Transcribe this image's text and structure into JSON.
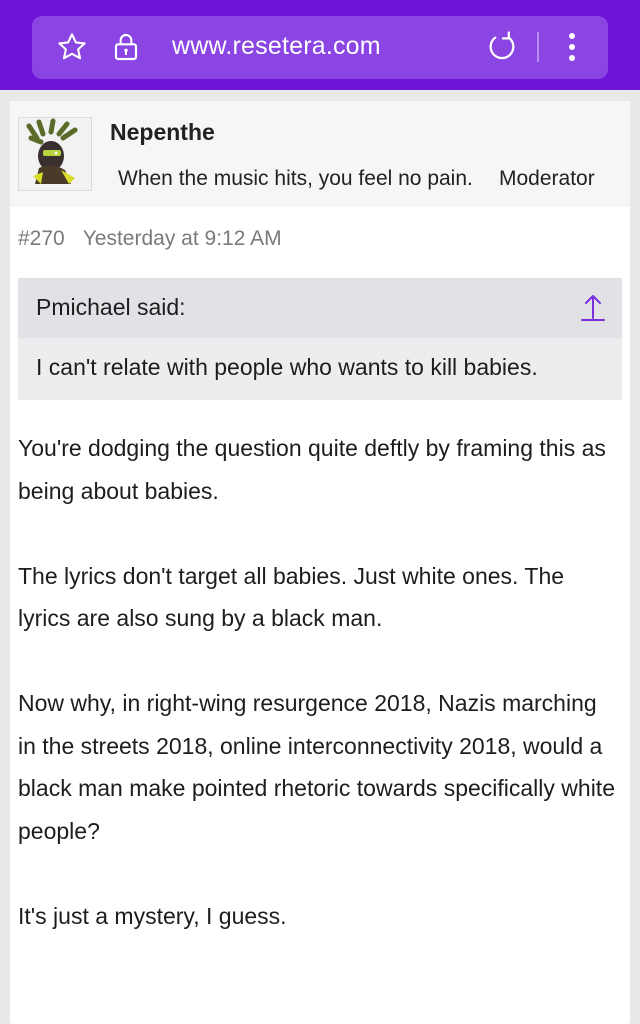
{
  "browser": {
    "url": "www.resetera.com",
    "colors": {
      "toolbar": "#6d14d6",
      "urlbar": "#8a45e3"
    },
    "icons": {
      "bookmark": "star-icon",
      "security": "lock-icon",
      "reload": "reload-icon",
      "menu": "more-vert-icon"
    }
  },
  "post": {
    "author": {
      "name": "Nepenthe",
      "title": "When the music hits, you feel no pain.",
      "role": "Moderator"
    },
    "number": "#270",
    "timestamp": "Yesterday at 9:12 AM",
    "quote": {
      "author_label": "Pmichael said:",
      "text": "I can't relate with people who wants to kill babies."
    },
    "paragraphs": [
      "You're dodging the question quite deftly by framing this as being about babies.",
      "The lyrics don't target all babies. Just white ones. The lyrics are also sung by a black man.",
      "Now why, in right-wing resurgence 2018, Nazis marching in the streets 2018, online interconnectivity 2018, would a black man make pointed rhetoric towards specifically white people?",
      "It's just a mystery, I guess."
    ]
  }
}
